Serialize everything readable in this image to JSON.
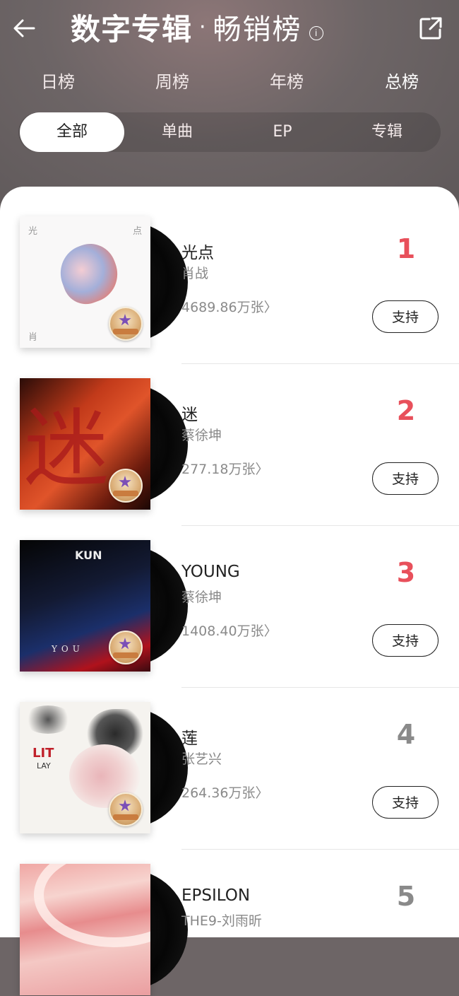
{
  "header": {
    "title_main": "数字专辑",
    "title_dot": "·",
    "title_sub": "畅销榜",
    "info_glyph": "i"
  },
  "period_tabs": [
    {
      "label": "日榜",
      "active": false
    },
    {
      "label": "周榜",
      "active": false
    },
    {
      "label": "年榜",
      "active": false
    },
    {
      "label": "总榜",
      "active": true
    }
  ],
  "type_tabs": [
    {
      "label": "全部",
      "active": true
    },
    {
      "label": "单曲",
      "active": false
    },
    {
      "label": "EP",
      "active": false
    },
    {
      "label": "专辑",
      "active": false
    }
  ],
  "albums": [
    {
      "rank": "1",
      "name": "光点",
      "artist": "肖战",
      "sales": "4689.86万张",
      "action": "支持",
      "rank_color": "#e8505b",
      "cover_text": {
        "tl": "光",
        "tr": "点",
        "bl": "肖"
      }
    },
    {
      "rank": "2",
      "name": "迷",
      "artist": "蔡徐坤",
      "sales": "277.18万张",
      "action": "支持",
      "rank_color": "#e8505b",
      "cover_text": {
        "big": "迷"
      }
    },
    {
      "rank": "3",
      "name": "YOUNG",
      "artist": "蔡徐坤",
      "sales": "1408.40万张",
      "action": "支持",
      "rank_color": "#e8505b",
      "cover_text": {
        "logo": "KUN",
        "bottom": "YOU"
      }
    },
    {
      "rank": "4",
      "name": "莲",
      "artist": "张艺兴",
      "sales": "264.36万张",
      "action": "支持",
      "rank_color": "#8a8a8a",
      "cover_text": {
        "logo": "LIT",
        "sub": "LAY"
      }
    },
    {
      "rank": "5",
      "name": "EPSILON",
      "artist": "THE9-刘雨昕",
      "rank_color": "#8a8a8a"
    }
  ],
  "icons": {
    "back": "arrow-left-icon",
    "share": "share-icon",
    "info": "info-icon",
    "chevron": "chevron-right-icon"
  },
  "chevron_glyph": "〉"
}
